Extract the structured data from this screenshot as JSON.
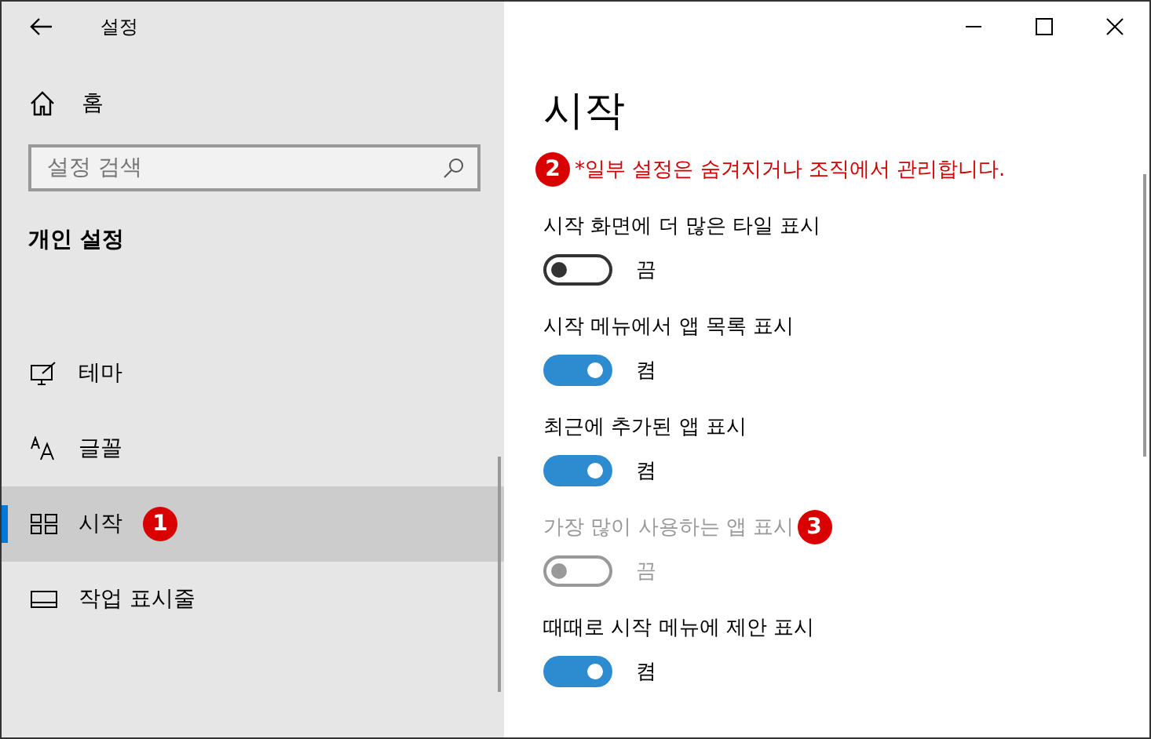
{
  "window": {
    "title": "설정"
  },
  "sidebar": {
    "home": "홈",
    "search": {
      "placeholder": "설정 검색"
    },
    "section": "개인 설정",
    "items": [
      {
        "label": "테마",
        "kind": "theme",
        "selected": false
      },
      {
        "label": "글꼴",
        "kind": "font",
        "selected": false
      },
      {
        "label": "시작",
        "kind": "start",
        "selected": true,
        "badge": "1"
      },
      {
        "label": "작업 표시줄",
        "kind": "taskbar",
        "selected": false
      }
    ]
  },
  "content": {
    "title": "시작",
    "notice": "*일부 설정은 숨겨지거나 조직에서 관리합니다.",
    "notice_badge": "2",
    "settings": [
      {
        "label": "시작 화면에 더 많은 타일 표시",
        "on": false,
        "disabled": false,
        "state": "끔"
      },
      {
        "label": "시작 메뉴에서 앱 목록 표시",
        "on": true,
        "disabled": false,
        "state": "켬"
      },
      {
        "label": "최근에 추가된 앱 표시",
        "on": true,
        "disabled": false,
        "state": "켬"
      },
      {
        "label": "가장 많이 사용하는 앱 표시",
        "on": false,
        "disabled": true,
        "state": "끔",
        "badge": "3"
      },
      {
        "label": "때때로 시작 메뉴에 제안 표시",
        "on": true,
        "disabled": false,
        "state": "켬"
      }
    ]
  }
}
